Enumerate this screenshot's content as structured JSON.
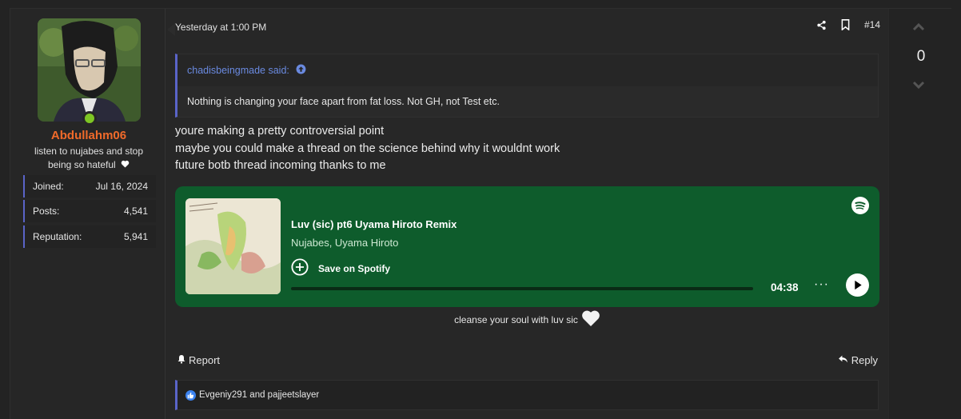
{
  "user": {
    "username": "Abdullahm06",
    "title": "listen to nujabes and stop being so hateful",
    "stats": [
      {
        "label": "Joined:",
        "value": "Jul 16, 2024"
      },
      {
        "label": "Posts:",
        "value": "4,541"
      },
      {
        "label": "Reputation:",
        "value": "5,941"
      }
    ],
    "status": "online"
  },
  "post": {
    "timestamp": "Yesterday at 1:00 PM",
    "number": "#14",
    "quote": {
      "author": "chadisbeingmade said:",
      "body": "Nothing is changing your face apart from fat loss. Not GH, not Test etc."
    },
    "message_lines": [
      "youre making a pretty controversial point",
      "maybe you could make a thread on the science behind why it wouldnt work",
      "future botb thread incoming thanks to me"
    ],
    "embed": {
      "track": "Luv (sic) pt6 Uyama Hiroto Remix",
      "artists": "Nujabes, Uyama Hiroto",
      "save_label": "Save on Spotify",
      "duration": "04:38",
      "more_label": "···",
      "progress": 0.0,
      "bg_color": "#0e5c2c"
    },
    "signature": "cleanse your soul with luv sic",
    "report_label": "Report",
    "reply_label": "Reply",
    "reactions_text": "Evgeniy291 and pajjeetslayer"
  },
  "votes": {
    "count": "0"
  },
  "colors": {
    "accent": "#5a64c8",
    "username": "#f06a2a",
    "online": "#7ec624",
    "quote_author": "#6a8ae0"
  }
}
